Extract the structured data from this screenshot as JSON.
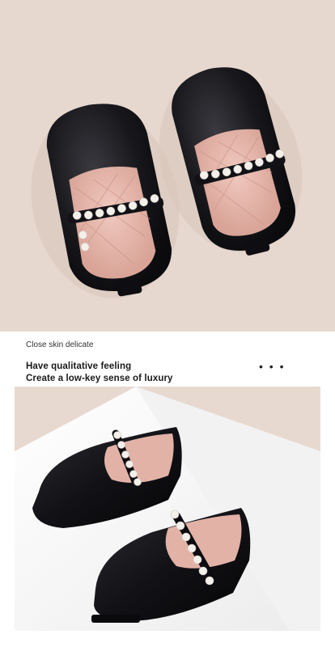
{
  "hero_image": {
    "description": "Pair of black leather Mary Jane shoes with pearl straps on beige background"
  },
  "caption": "Close skin delicate",
  "headline": {
    "line1": "Have qualitative feeling",
    "line2": "Create a low-key sense of luxury"
  },
  "more_menu": "• • •",
  "colors": {
    "hero_bg": "#e7d8cf",
    "shoe_black": "#16161a",
    "insole_pink": "#e6b8ae",
    "pearl": "#f3efea",
    "scene_bg": "#e8d9d0",
    "white_block": "#f7f7f7"
  }
}
